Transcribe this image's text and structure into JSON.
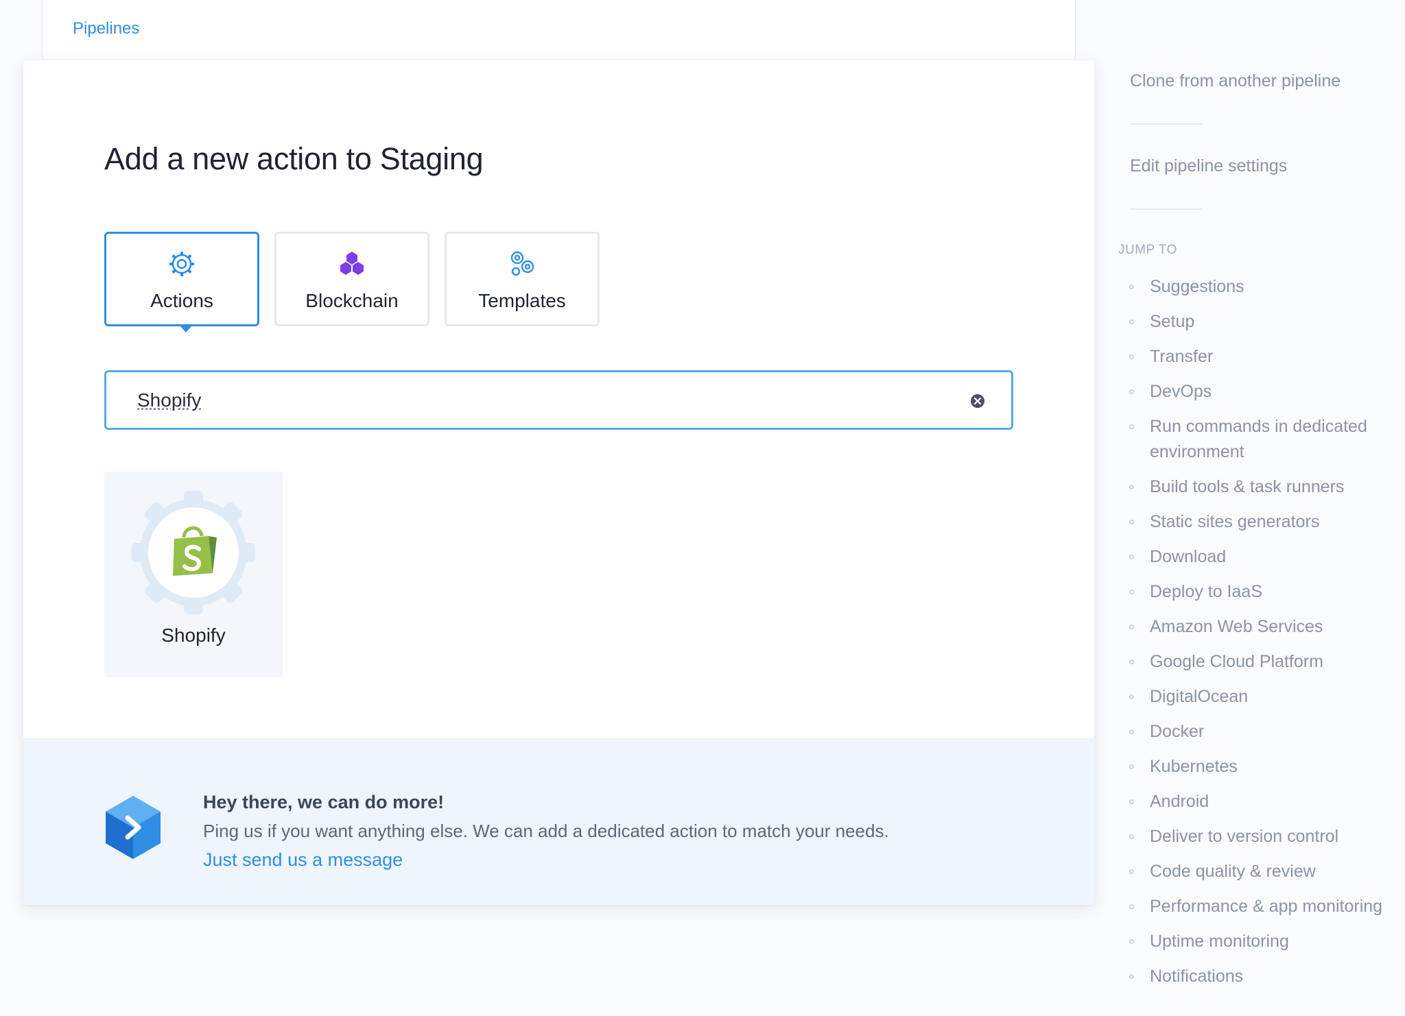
{
  "breadcrumb": "Pipelines",
  "modal": {
    "title": "Add a new action to Staging",
    "tabs": [
      {
        "label": "Actions",
        "icon": "gear-icon",
        "active": true
      },
      {
        "label": "Blockchain",
        "icon": "blockchain-icon",
        "active": false
      },
      {
        "label": "Templates",
        "icon": "templates-icon",
        "active": false
      }
    ],
    "search": {
      "value": "Shopify"
    },
    "results": [
      {
        "label": "Shopify",
        "icon": "shopify-icon"
      }
    ],
    "promo": {
      "title": "Hey there, we can do more!",
      "text": "Ping us if you want anything else. We can add a dedicated action to match your needs.",
      "link": "Just send us a message"
    }
  },
  "sidebar": {
    "clone_label": "Clone from another pipeline",
    "edit_label": "Edit pipeline settings",
    "jump_heading": "JUMP TO",
    "jump_items": [
      "Suggestions",
      "Setup",
      "Transfer",
      "DevOps",
      "Run commands in dedicated environment",
      "Build tools & task runners",
      "Static sites generators",
      "Download",
      "Deploy to IaaS",
      "Amazon Web Services",
      "Google Cloud Platform",
      "DigitalOcean",
      "Docker",
      "Kubernetes",
      "Android",
      "Deliver to version control",
      "Code quality & review",
      "Performance & app monitoring",
      "Uptime monitoring",
      "Notifications"
    ]
  },
  "colors": {
    "accent": "#2f8de4",
    "shopify_green": "#95bf47",
    "blockchain_purple": "#7b3fe4"
  }
}
